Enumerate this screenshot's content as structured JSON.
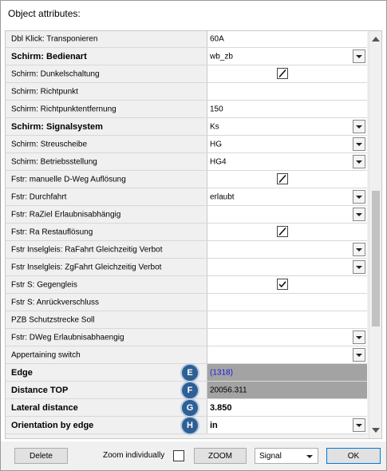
{
  "dialog": {
    "title": "Object attributes:"
  },
  "rows": [
    {
      "name": "Dbl Klick: Transponieren",
      "bold": false,
      "value": "60A",
      "control": "none"
    },
    {
      "name": "Schirm: Bedienart",
      "bold": true,
      "value": "wb_zb",
      "control": "dropdown"
    },
    {
      "name": "Schirm: Dunkelschaltung",
      "bold": false,
      "value": "",
      "control": "checkbox",
      "checked": true
    },
    {
      "name": "Schirm: Richtpunkt",
      "bold": false,
      "value": "",
      "control": "none"
    },
    {
      "name": "Schirm: Richtpunktentfernung",
      "bold": false,
      "value": "150",
      "control": "none"
    },
    {
      "name": "Schirm: Signalsystem",
      "bold": true,
      "value": "Ks",
      "control": "dropdown"
    },
    {
      "name": "Schirm: Streuscheibe",
      "bold": false,
      "value": "HG",
      "control": "dropdown"
    },
    {
      "name": "Schirm: Betriebsstellung",
      "bold": false,
      "value": "HG4",
      "control": "dropdown"
    },
    {
      "name": "Fstr: manuelle D-Weg Auflösung",
      "bold": false,
      "value": "",
      "control": "checkbox",
      "checked": true
    },
    {
      "name": "Fstr: Durchfahrt",
      "bold": false,
      "value": "erlaubt",
      "control": "dropdown"
    },
    {
      "name": "Fstr: RaZiel Erlaubnisabhängig",
      "bold": false,
      "value": "",
      "control": "dropdown"
    },
    {
      "name": "Fstr: Ra Restauflösung",
      "bold": false,
      "value": "",
      "control": "checkbox",
      "checked": true
    },
    {
      "name": "Fstr Inselgleis: RaFahrt Gleichzeitig Verbot",
      "bold": false,
      "value": "",
      "control": "dropdown"
    },
    {
      "name": "Fstr Inselgleis: ZgFahrt Gleichzeitig Verbot",
      "bold": false,
      "value": "",
      "control": "dropdown"
    },
    {
      "name": "Fstr S: Gegengleis",
      "bold": false,
      "value": "",
      "control": "checkbox",
      "checked": true
    },
    {
      "name": "Fstr S: Anrückverschluss",
      "bold": false,
      "value": "",
      "control": "none"
    },
    {
      "name": "PZB Schutzstrecke Soll",
      "bold": false,
      "value": "",
      "control": "none"
    },
    {
      "name": "Fstr: DWeg Erlaubnisabhaengig",
      "bold": false,
      "value": "",
      "control": "dropdown"
    },
    {
      "name": "Appertaining switch",
      "bold": false,
      "value": "",
      "control": "dropdown"
    },
    {
      "name": "Edge",
      "bold": true,
      "value": "(1318)",
      "control": "none",
      "gray": true,
      "link": true,
      "badge": "E"
    },
    {
      "name": "Distance TOP",
      "bold": true,
      "value": "20056.311",
      "control": "none",
      "gray": true,
      "badge": "F"
    },
    {
      "name": "Lateral distance",
      "bold": true,
      "value": "3.850",
      "control": "none",
      "valueBold": true,
      "badge": "G"
    },
    {
      "name": "Orientation by edge",
      "bold": true,
      "value": "in",
      "control": "dropdown",
      "valueBold": true,
      "badge": "H"
    }
  ],
  "footer": {
    "delete_label": "Delete",
    "zoom_individually_label": "Zoom individually",
    "zoom_individually_checked": false,
    "zoom_label": "ZOOM",
    "type_select_value": "Signal",
    "ok_label": "OK"
  },
  "colors": {
    "badge": "#2e5f95",
    "link": "#1a1ae0",
    "gray_cell": "#a3a3a3"
  }
}
